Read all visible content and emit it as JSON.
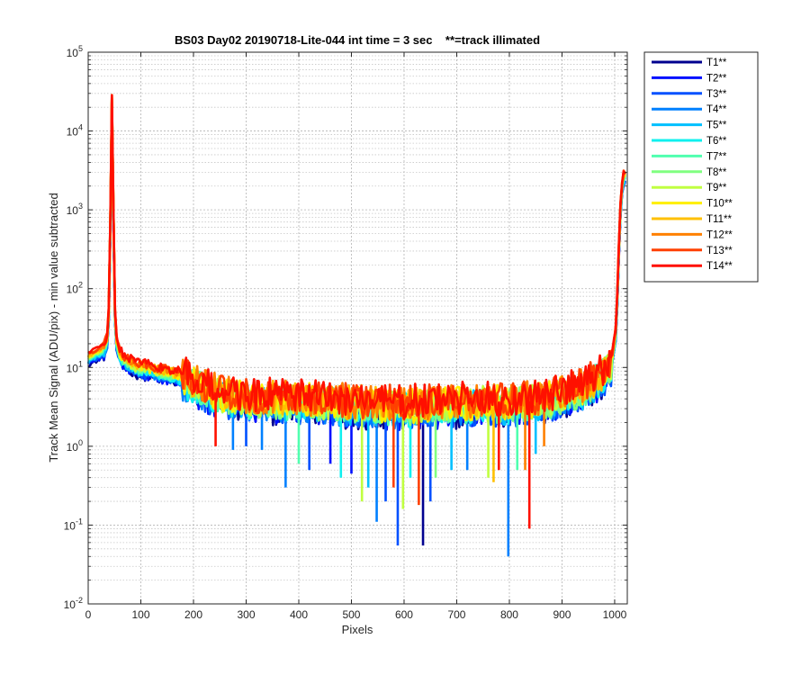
{
  "chart_data": {
    "type": "line",
    "title": "BS03 Day02 20190718-Lite-044 int time = 3 sec    **=track illimated",
    "xlabel": "Pixels",
    "ylabel": "Track Mean Signal (ADU/pix) - min value subtracted",
    "xlim": [
      0,
      1024
    ],
    "ylim": [
      0.01,
      100000
    ],
    "yscale": "log",
    "xticks": [
      0,
      100,
      200,
      300,
      400,
      500,
      600,
      700,
      800,
      900,
      1000
    ],
    "yticks": [
      0.01,
      0.1,
      1,
      10,
      100,
      1000,
      10000,
      100000
    ],
    "yticklabels": [
      {
        "base": "10",
        "exp": "-2"
      },
      {
        "base": "10",
        "exp": "-1"
      },
      {
        "base": "10",
        "exp": "0"
      },
      {
        "base": "10",
        "exp": "1"
      },
      {
        "base": "10",
        "exp": "2"
      },
      {
        "base": "10",
        "exp": "3"
      },
      {
        "base": "10",
        "exp": "4"
      },
      {
        "base": "10",
        "exp": "5"
      }
    ],
    "grid": true,
    "minor_grid": true,
    "legend_position": "outside-top-right",
    "profile": {
      "x": [
        0,
        10,
        20,
        30,
        36,
        40,
        43,
        45,
        47,
        50,
        54,
        60,
        70,
        90,
        120,
        160,
        200,
        230,
        260,
        300,
        400,
        500,
        600,
        700,
        800,
        880,
        940,
        980,
        995,
        1003,
        1008,
        1012,
        1016,
        1020,
        1024
      ],
      "y": [
        13,
        14,
        15,
        17,
        22,
        60,
        2000,
        25000,
        3000,
        60,
        20,
        14,
        12,
        10,
        9,
        8,
        6.5,
        5,
        4.5,
        4,
        3.8,
        3.5,
        3.2,
        3.5,
        3.5,
        4,
        5.5,
        8.5,
        12,
        30,
        300,
        1500,
        2500,
        2600,
        2200
      ]
    },
    "series": [
      {
        "name": "T1**",
        "color": "#00008f"
      },
      {
        "name": "T2**",
        "color": "#0010ff"
      },
      {
        "name": "T3**",
        "color": "#0050ff"
      },
      {
        "name": "T4**",
        "color": "#0080ff"
      },
      {
        "name": "T5**",
        "color": "#00c0ff"
      },
      {
        "name": "T6**",
        "color": "#10f0ef"
      },
      {
        "name": "T7**",
        "color": "#50ffaf"
      },
      {
        "name": "T8**",
        "color": "#80ff80"
      },
      {
        "name": "T9**",
        "color": "#c0ff40"
      },
      {
        "name": "T10**",
        "color": "#ffef00"
      },
      {
        "name": "T11**",
        "color": "#ffc000"
      },
      {
        "name": "T12**",
        "color": "#ff8000"
      },
      {
        "name": "T13**",
        "color": "#ff4000"
      },
      {
        "name": "T14**",
        "color": "#ff1000"
      }
    ],
    "dips": [
      {
        "x": 242,
        "y": 1.0,
        "series": "T14**"
      },
      {
        "x": 275,
        "y": 0.9,
        "series": "T4**"
      },
      {
        "x": 300,
        "y": 1.0,
        "series": "T3**"
      },
      {
        "x": 330,
        "y": 0.9,
        "series": "T4**"
      },
      {
        "x": 375,
        "y": 0.3,
        "series": "T4**"
      },
      {
        "x": 400,
        "y": 0.6,
        "series": "T7**"
      },
      {
        "x": 420,
        "y": 0.5,
        "series": "T3**"
      },
      {
        "x": 460,
        "y": 0.6,
        "series": "T2**"
      },
      {
        "x": 480,
        "y": 0.4,
        "series": "T6**"
      },
      {
        "x": 500,
        "y": 0.45,
        "series": "T2**"
      },
      {
        "x": 520,
        "y": 0.2,
        "series": "T9**"
      },
      {
        "x": 532,
        "y": 0.3,
        "series": "T5**"
      },
      {
        "x": 548,
        "y": 0.11,
        "series": "T4**"
      },
      {
        "x": 565,
        "y": 0.2,
        "series": "T3**"
      },
      {
        "x": 580,
        "y": 0.3,
        "series": "T13**"
      },
      {
        "x": 588,
        "y": 0.055,
        "series": "T3**"
      },
      {
        "x": 598,
        "y": 0.16,
        "series": "T9**"
      },
      {
        "x": 612,
        "y": 0.4,
        "series": "T6**"
      },
      {
        "x": 628,
        "y": 0.18,
        "series": "T13**"
      },
      {
        "x": 636,
        "y": 0.055,
        "series": "T1**"
      },
      {
        "x": 650,
        "y": 0.2,
        "series": "T3**"
      },
      {
        "x": 660,
        "y": 0.4,
        "series": "T8**"
      },
      {
        "x": 690,
        "y": 0.5,
        "series": "T5**"
      },
      {
        "x": 720,
        "y": 0.5,
        "series": "T4**"
      },
      {
        "x": 760,
        "y": 0.4,
        "series": "T9**"
      },
      {
        "x": 770,
        "y": 0.35,
        "series": "T11**"
      },
      {
        "x": 780,
        "y": 0.5,
        "series": "T14**"
      },
      {
        "x": 798,
        "y": 0.04,
        "series": "T4**"
      },
      {
        "x": 815,
        "y": 0.5,
        "series": "T7**"
      },
      {
        "x": 830,
        "y": 0.5,
        "series": "T12**"
      },
      {
        "x": 838,
        "y": 0.09,
        "series": "T14**"
      },
      {
        "x": 850,
        "y": 0.8,
        "series": "T5**"
      },
      {
        "x": 866,
        "y": 1.0,
        "series": "T12**"
      }
    ]
  }
}
